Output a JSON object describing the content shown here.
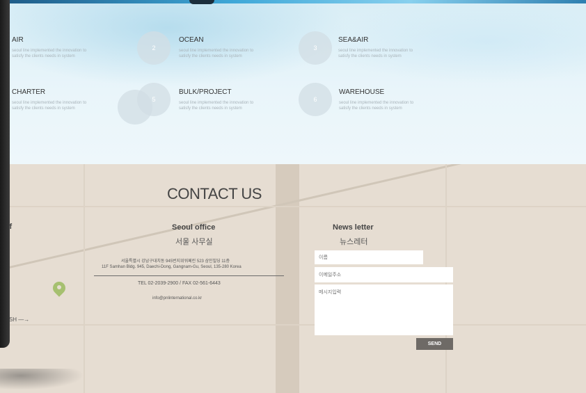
{
  "services": [
    {
      "title": "AIR",
      "number": "",
      "desc1": "seoul line implemented the innovation to",
      "desc2": "satisfy the clients needs in system"
    },
    {
      "title": "OCEAN",
      "number": "2",
      "desc1": "seoul line implemented the innovation to",
      "desc2": "satisfy the clients needs in system"
    },
    {
      "title": "SEA&AIR",
      "number": "3",
      "desc1": "seoul line implemented the innovation to",
      "desc2": "satisfy the clients needs in system"
    },
    {
      "title": "CHARTER",
      "number": "",
      "desc1": "seoul line implemented the innovation to",
      "desc2": "satisfy the clients needs in system"
    },
    {
      "title": "BULK/PROJECT",
      "number": "5",
      "desc1": "seoul line implemented the innovation to",
      "desc2": "satisfy the clients needs in system"
    },
    {
      "title": "WAREHOUSE",
      "number": "6",
      "desc1": "seoul line implemented the innovation to",
      "desc2": "satisfy the clients needs in system"
    }
  ],
  "contact": {
    "title": "CONTACT US",
    "brief_partial": "rief",
    "english_partial": "GLISH —→",
    "office": {
      "heading": "Seoul office",
      "heading_kr": "서울 사무실",
      "address_kr": "서울특별시 강남구대치동 945번지위워페린 523 삼인빌딩 11층",
      "address_en": "11F Samhan Bldg. 945, Daechi-Dong, Gangnam-Gu, Seoul, 135-280 Korea",
      "tel_fax": "TEL 02-2039-2900 / FAX 02-561-6443",
      "email": "info@pnlinternational.co.kr"
    },
    "newsletter": {
      "heading": "News letter",
      "heading_kr": "뉴스레터",
      "name_placeholder": "이름",
      "email_placeholder": "이메일주소",
      "message_placeholder": "메시지입력",
      "send_label": "SEND"
    }
  },
  "colors": {
    "accent_blue": "#3fa8d8",
    "send_button": "#6e6a66",
    "map_bg": "#e6ddd2",
    "pin": "#a6c070"
  }
}
